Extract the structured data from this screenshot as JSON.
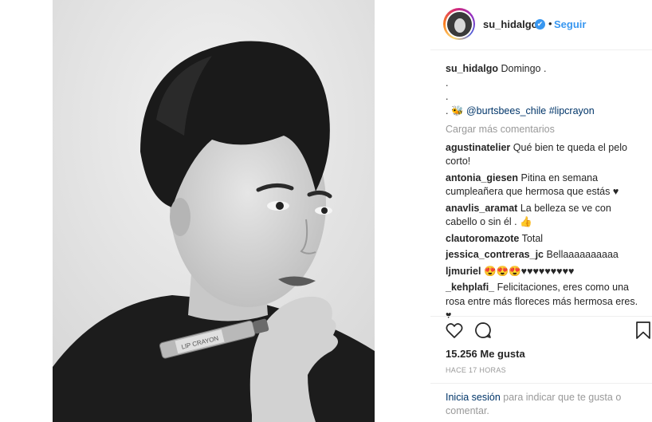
{
  "post": {
    "username": "su_hidalgo",
    "verified_icon": "verified-badge-icon",
    "follow_separator": "•",
    "follow_label": "Seguir",
    "image_icon": "portrait-photo"
  },
  "caption": {
    "username": "su_hidalgo",
    "text": "Domingo .",
    "line2": ".",
    "line3": ".",
    "line4_prefix": ". 🐝 ",
    "mention": "@burtsbees_chile",
    "hashtag": "#lipcrayon"
  },
  "load_more_label": "Cargar más comentarios",
  "comments": [
    {
      "user": "agustinatelier",
      "text": "Qué bien te queda el pelo corto!"
    },
    {
      "user": "antonia_giesen",
      "text": "Pitina en semana cumpleañera que hermosa que estás ♥"
    },
    {
      "user": "anavlis_aramat",
      "text": "La belleza se ve con cabello o sin él . 👍"
    },
    {
      "user": "clautoromazote",
      "text": "Total"
    },
    {
      "user": "jessica_contreras_jc",
      "text": "Bellaaaaaaaaaa"
    },
    {
      "user": "ljmuriel",
      "text": "😍😍😍♥♥♥♥♥♥♥♥♥"
    },
    {
      "user": "_kehplafi_",
      "text": "Felicitaciones, eres como una rosa entre más floreces más hermosa eres. ♥"
    }
  ],
  "actions": {
    "like_icon": "heart-icon",
    "comment_icon": "comment-bubble-icon",
    "save_icon": "bookmark-icon"
  },
  "likes_label": "15.256 Me gusta",
  "time_label": "HACE 17 HORAS",
  "login": {
    "link_label": "Inicia sesión",
    "rest": " para indicar que te gusta o comentar."
  }
}
